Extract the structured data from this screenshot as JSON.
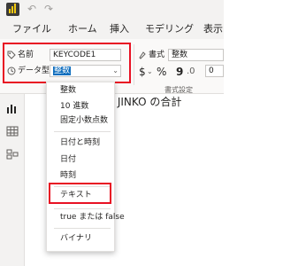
{
  "titlebar": {
    "undo_icon": "undo-icon",
    "redo_icon": "redo-icon"
  },
  "ribbon_tabs": [
    "ファイル",
    "ホーム",
    "挿入",
    "モデリング",
    "表示"
  ],
  "properties": {
    "name_label": "名前",
    "name_value": "KEYCODE1",
    "datatype_label": "データ型",
    "datatype_value": "整数"
  },
  "format": {
    "label": "書式",
    "value": "整数",
    "currency_symbol": "$",
    "percent_symbol": "%",
    "comma_symbol": "9",
    "decimal_value": "0",
    "group_label": "書式設定"
  },
  "datatype_menu": {
    "items": [
      "整数",
      "10 進数",
      "固定小数点数",
      "日付と時刻",
      "日付",
      "時刻",
      "テキスト",
      "true または false",
      "バイナリ"
    ]
  },
  "canvas": {
    "title": "する JINKO の合計"
  },
  "colors": {
    "highlight": "#e81123",
    "selection": "#106ebe"
  }
}
